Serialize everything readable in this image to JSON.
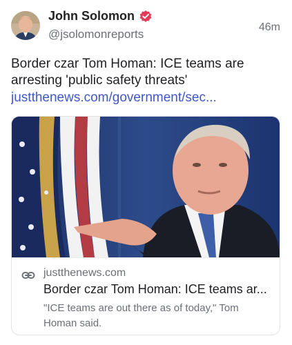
{
  "author": {
    "name": "John Solomon",
    "handle": "@jsolomonreports",
    "verified": true
  },
  "post": {
    "time": "46m",
    "text": "Border czar Tom Homan: ICE teams are arresting 'public safety threats'",
    "link": "justthenews.com/government/sec..."
  },
  "link_card": {
    "domain": "justthenews.com",
    "title": "Border czar Tom Homan: ICE teams ar...",
    "description": "\"ICE teams are out there as of today,\" Tom Homan said."
  },
  "colors": {
    "verified_badge": "#e33c5a",
    "link": "#3f58c8",
    "secondary_text": "#6b6f78"
  },
  "icons": [
    "verified-badge-icon",
    "link-icon"
  ]
}
